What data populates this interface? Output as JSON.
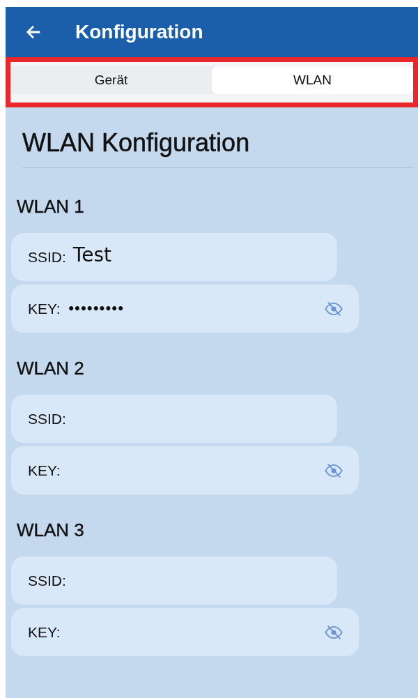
{
  "app_bar": {
    "title": "Konfiguration"
  },
  "tabs": [
    {
      "label": "Gerät",
      "selected": false
    },
    {
      "label": "WLAN",
      "selected": true
    }
  ],
  "section_title": "WLAN Konfiguration",
  "networks": [
    {
      "title": "WLAN 1",
      "ssid": {
        "label": "SSID:",
        "value": "Test"
      },
      "key": {
        "label": "KEY:",
        "value": "•••••••••"
      }
    },
    {
      "title": "WLAN 2",
      "ssid": {
        "label": "SSID:"
      },
      "key": {
        "label": "KEY:"
      }
    },
    {
      "title": "WLAN 3",
      "ssid": {
        "label": "SSID:"
      },
      "key": {
        "label": "KEY:"
      }
    }
  ]
}
